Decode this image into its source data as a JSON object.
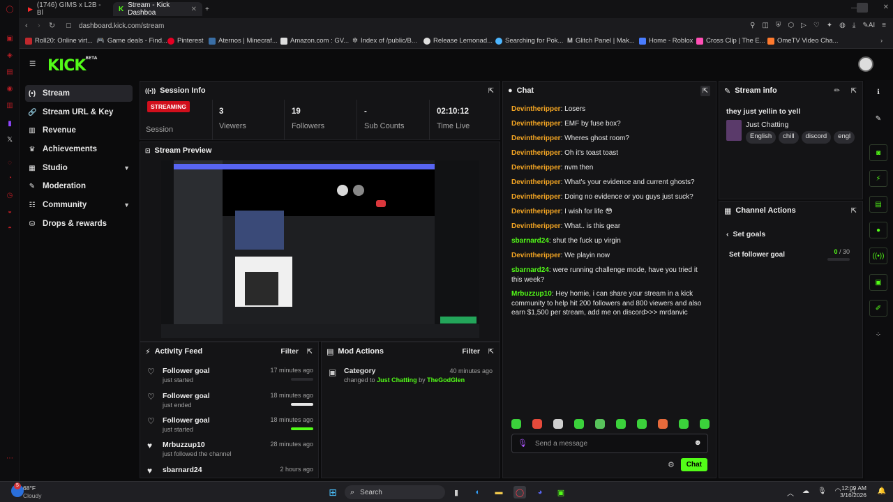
{
  "browser": {
    "tabs": [
      {
        "label": "(1746) GIMS x L2B - Bl",
        "active": false
      },
      {
        "label": "Stream - Kick Dashboa",
        "active": true
      }
    ],
    "url": "dashboard.kick.com/stream",
    "bookmarks": [
      "Roll20: Online virt...",
      "Game deals - Find...",
      "Pinterest",
      "Aternos | Minecraf...",
      "Amazon.com : GV...",
      "Index of /public/B...",
      "Release Lemonad...",
      "Searching for Pok...",
      "Glitch Panel | Mak...",
      "Home - Roblox",
      "Cross Clip | The E...",
      "OmeTV Video Cha..."
    ],
    "ai_label": "AI"
  },
  "kick": {
    "logo": "KICK",
    "logo_sup": "BETA",
    "nav": [
      {
        "label": "Stream",
        "icon": "broadcast-icon",
        "active": true,
        "chevron": false
      },
      {
        "label": "Stream URL & Key",
        "icon": "link-icon",
        "active": false,
        "chevron": false
      },
      {
        "label": "Revenue",
        "icon": "chart-icon",
        "active": false,
        "chevron": false
      },
      {
        "label": "Achievements",
        "icon": "trophy-icon",
        "active": false,
        "chevron": false
      },
      {
        "label": "Studio",
        "icon": "studio-icon",
        "active": false,
        "chevron": true
      },
      {
        "label": "Moderation",
        "icon": "wrench-icon",
        "active": false,
        "chevron": false
      },
      {
        "label": "Community",
        "icon": "community-icon",
        "active": false,
        "chevron": true
      },
      {
        "label": "Drops & rewards",
        "icon": "gift-icon",
        "active": false,
        "chevron": false
      }
    ]
  },
  "session": {
    "title": "Session Info",
    "badge": "STREAMING",
    "session_label": "Session",
    "stats": [
      {
        "value": "3",
        "label": "Viewers"
      },
      {
        "value": "19",
        "label": "Followers"
      },
      {
        "value": "-",
        "label": "Sub Counts"
      },
      {
        "value": "02:10:12",
        "label": "Time Live"
      }
    ]
  },
  "preview": {
    "title": "Stream Preview"
  },
  "activity": {
    "title": "Activity Feed",
    "filter": "Filter",
    "items": [
      {
        "title": "Follower goal",
        "sub": "just started",
        "time": "17 minutes ago",
        "progress": 0,
        "filled_heart": false
      },
      {
        "title": "Follower goal",
        "sub": "just ended",
        "time": "18 minutes ago",
        "progress": 1,
        "filled_heart": false
      },
      {
        "title": "Follower goal",
        "sub": "just started",
        "time": "18 minutes ago",
        "progress": 1,
        "filled_heart": false
      },
      {
        "title": "Mrbuzzup10",
        "sub": "just followed the channel",
        "time": "28 minutes ago",
        "progress": null,
        "filled_heart": true
      },
      {
        "title": "sbarnard24",
        "sub": "",
        "time": "2 hours ago",
        "progress": null,
        "filled_heart": true
      }
    ]
  },
  "mod": {
    "title": "Mod Actions",
    "filter": "Filter",
    "item": {
      "title": "Category",
      "time": "40 minutes ago",
      "pre": "changed to",
      "category": "Just Chatting",
      "by": "by",
      "user": "TheGodGlen"
    }
  },
  "chat": {
    "title": "Chat",
    "messages": [
      {
        "user": "Devintheripper",
        "color": "#f5a623",
        "text": ": Losers"
      },
      {
        "user": "Devintheripper",
        "color": "#f5a623",
        "text": ": EMF by fuse box?"
      },
      {
        "user": "Devintheripper",
        "color": "#f5a623",
        "text": ": Wheres ghost room?"
      },
      {
        "user": "Devintheripper",
        "color": "#f5a623",
        "text": ": Oh it's toast toast"
      },
      {
        "user": "Devintheripper",
        "color": "#f5a623",
        "text": ": nvm then"
      },
      {
        "user": "Devintheripper",
        "color": "#f5a623",
        "text": ": What's your evidence and current ghosts?"
      },
      {
        "user": "Devintheripper",
        "color": "#f5a623",
        "text": ": Doing no evidence or you guys just suck?"
      },
      {
        "user": "Devintheripper",
        "color": "#f5a623",
        "text": ": I wish for life 😳"
      },
      {
        "user": "Devintheripper",
        "color": "#f5a623",
        "text": ": What.. is this gear"
      },
      {
        "user": "sbarnard24",
        "color": "#53fc18",
        "text": ": shut the fuck up virgin"
      },
      {
        "user": "Devintheripper",
        "color": "#f5a623",
        "text": ": We playin now"
      },
      {
        "user": "sbarnard24",
        "color": "#53fc18",
        "text": ": were running challenge mode, have you tried it this week?"
      },
      {
        "user": "Mrbuzzup10",
        "color": "#53fc18",
        "text": ": Hey homie, i can share your stream in a kick community to help hit 200 followers and 800 viewers and also earn $1,500 per stream, add me on discord>>> mrdanvic"
      }
    ],
    "placeholder": "Send a message",
    "send": "Chat"
  },
  "stream_info": {
    "title": "Stream info",
    "stream_title": "they just yellin to yell",
    "category": "Just Chatting",
    "tags": [
      "English",
      "chill",
      "discord",
      "engl"
    ]
  },
  "channel_actions": {
    "title": "Channel Actions",
    "back": "Set goals",
    "goal_label": "Set follower goal",
    "goal_current": "0",
    "goal_total": " / 30",
    "goal_progress": 0
  },
  "taskbar": {
    "weather_temp": "68°F",
    "weather_desc": "Cloudy",
    "notif_count": "5",
    "search": "Search",
    "time": "12:09 AM",
    "date": "3/16/2026"
  },
  "colors": {
    "accent": "#53fc18",
    "live": "#d10f1c",
    "bg": "#0b0b0c",
    "panel": "#141416"
  }
}
